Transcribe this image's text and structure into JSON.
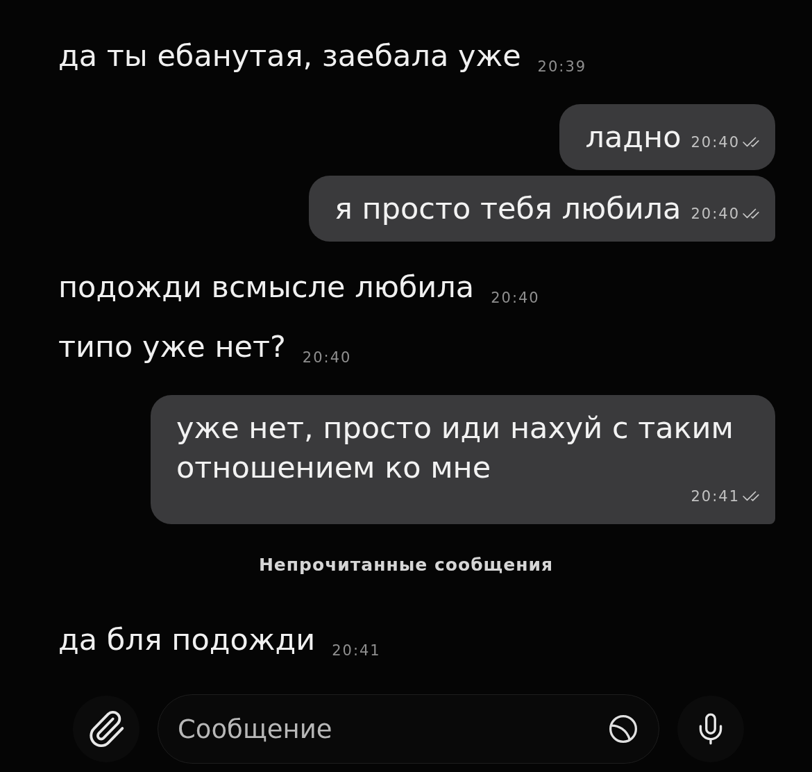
{
  "messages": [
    {
      "kind": "incoming",
      "text": "да ты ебанутая, заебала уже",
      "time": "20:39"
    },
    {
      "kind": "outgoing",
      "text": "ладно",
      "time": "20:40",
      "read": true
    },
    {
      "kind": "outgoing",
      "text": "я просто тебя любила",
      "time": "20:40",
      "read": true
    },
    {
      "kind": "incoming",
      "text": "подожди всмысле любила",
      "time": "20:40"
    },
    {
      "kind": "incoming",
      "text": "типо уже нет?",
      "time": "20:40"
    },
    {
      "kind": "outgoing",
      "text": "уже нет, просто иди нахуй с таким отношением ко мне",
      "time": "20:41",
      "read": true
    },
    {
      "kind": "divider",
      "text": "Непрочитанные сообщения"
    },
    {
      "kind": "incoming",
      "text": "да бля подожди",
      "time": "20:41"
    }
  ],
  "composer": {
    "placeholder": "Сообщение"
  }
}
